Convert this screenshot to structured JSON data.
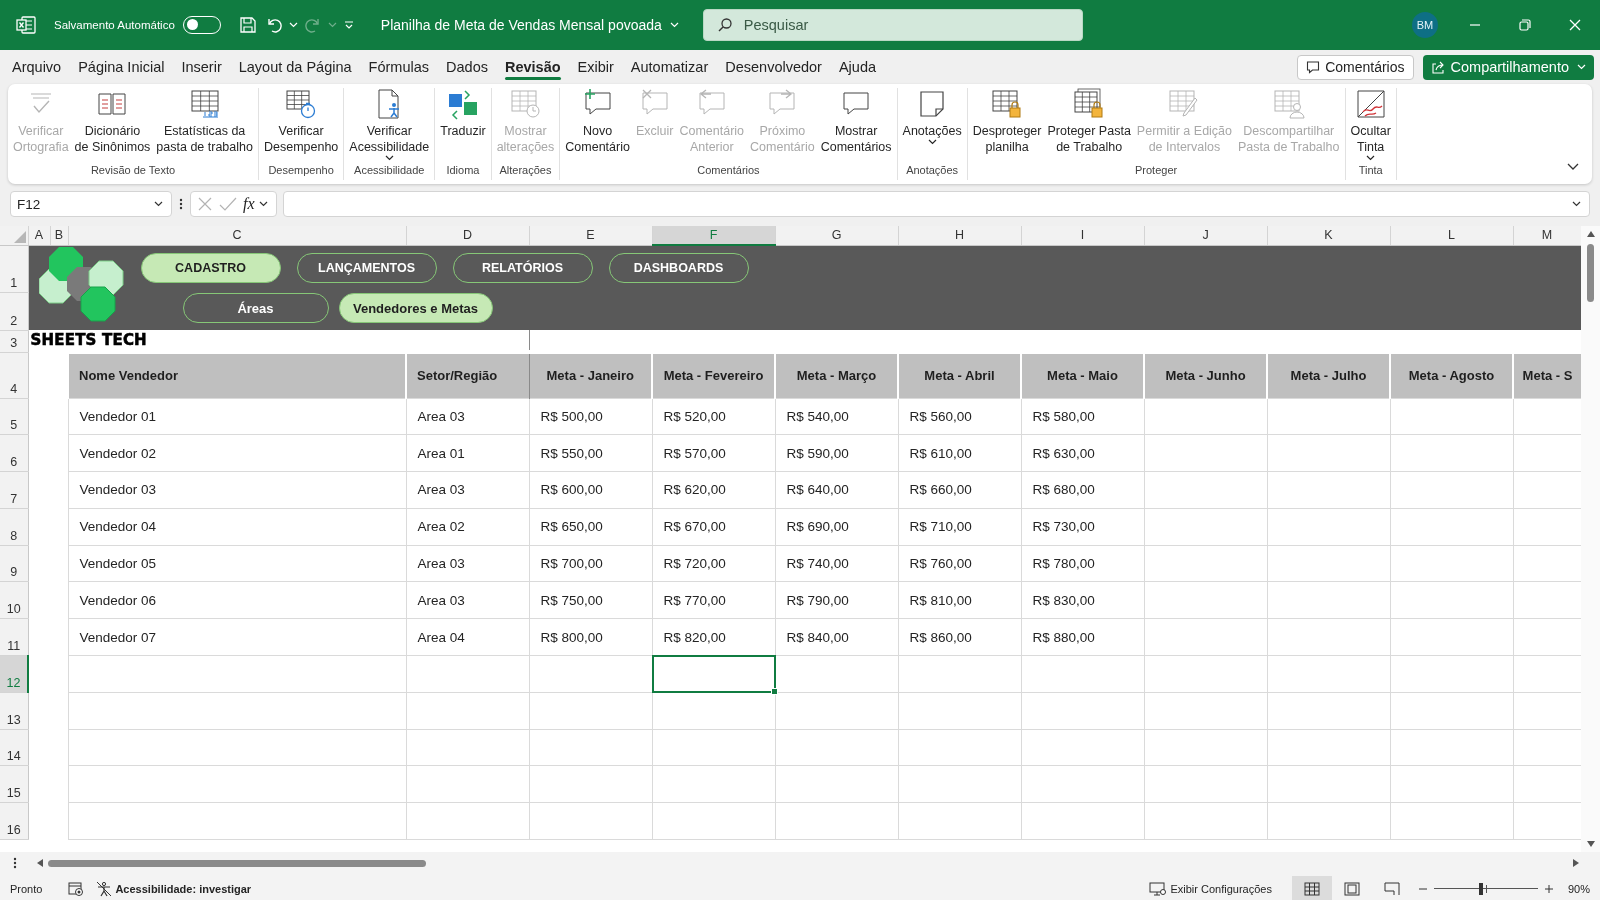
{
  "title_bar": {
    "autosave": {
      "label": "Salvamento Automático",
      "on": false
    },
    "redo": {
      "disabled": true
    },
    "document_title": "Planilha de Meta de Vendas Mensal povoada",
    "search": {
      "placeholder": "Pesquisar"
    },
    "user_initials": "BM"
  },
  "menu_tabs": [
    {
      "label": "Arquivo",
      "selected": false
    },
    {
      "label": "Página Inicial",
      "selected": false
    },
    {
      "label": "Inserir",
      "selected": false
    },
    {
      "label": "Layout da Página",
      "selected": false
    },
    {
      "label": "Fórmulas",
      "selected": false
    },
    {
      "label": "Dados",
      "selected": false
    },
    {
      "label": "Revisão",
      "selected": true
    },
    {
      "label": "Exibir",
      "selected": false
    },
    {
      "label": "Automatizar",
      "selected": false
    },
    {
      "label": "Desenvolvedor",
      "selected": false
    },
    {
      "label": "Ajuda",
      "selected": false
    }
  ],
  "header_buttons": {
    "comments": "Comentários",
    "share": "Compartilhamento"
  },
  "ribbon_groups": [
    {
      "label": "Revisão de Texto",
      "commands": [
        {
          "label": "Verificar\nOrtografia",
          "disabled": true,
          "has_menu": false
        },
        {
          "label": "Dicionário\nde Sinônimos",
          "disabled": false,
          "has_menu": false
        },
        {
          "label": "Estatísticas da\npasta de trabalho",
          "disabled": false,
          "has_menu": false
        }
      ]
    },
    {
      "label": "Desempenho",
      "commands": [
        {
          "label": "Verificar\nDesempenho",
          "disabled": false,
          "has_menu": false
        }
      ]
    },
    {
      "label": "Acessibilidade",
      "commands": [
        {
          "label": "Verificar\nAcessibilidade",
          "disabled": false,
          "has_menu": true
        }
      ]
    },
    {
      "label": "Idioma",
      "commands": [
        {
          "label": "Traduzir",
          "disabled": false,
          "has_menu": false
        }
      ]
    },
    {
      "label": "Alterações",
      "commands": [
        {
          "label": "Mostrar\nalterações",
          "disabled": true,
          "has_menu": false
        }
      ]
    },
    {
      "label": "Comentários",
      "commands": [
        {
          "label": "Novo\nComentário",
          "disabled": false,
          "has_menu": false
        },
        {
          "label": "Excluir",
          "disabled": true,
          "has_menu": false
        },
        {
          "label": "Comentário\nAnterior",
          "disabled": true,
          "has_menu": false
        },
        {
          "label": "Próximo\nComentário",
          "disabled": true,
          "has_menu": false
        },
        {
          "label": "Mostrar\nComentários",
          "disabled": false,
          "has_menu": false
        }
      ]
    },
    {
      "label": "Anotações",
      "commands": [
        {
          "label": "Anotações",
          "disabled": false,
          "has_menu": true
        }
      ]
    },
    {
      "label": "Proteger",
      "commands": [
        {
          "label": "Desproteger\nplanilha",
          "disabled": false,
          "has_menu": false
        },
        {
          "label": "Proteger Pasta\nde Trabalho",
          "disabled": false,
          "has_menu": false
        },
        {
          "label": "Permitir a Edição\nde Intervalos",
          "disabled": true,
          "has_menu": false
        },
        {
          "label": "Descompartilhar\nPasta de Trabalho",
          "disabled": true,
          "has_menu": false
        }
      ]
    },
    {
      "label": "Tinta",
      "commands": [
        {
          "label": "Ocultar\nTinta",
          "disabled": false,
          "has_menu": true
        }
      ]
    }
  ],
  "formula_bar": {
    "name_box": "F12",
    "edit_buttons_disabled": true,
    "function_label": "fx"
  },
  "column_bar": [
    {
      "letter": "A",
      "selected": false
    },
    {
      "letter": "B",
      "selected": false
    },
    {
      "letter": "C",
      "selected": false
    },
    {
      "letter": "D",
      "selected": false
    },
    {
      "letter": "E",
      "selected": false
    },
    {
      "letter": "F",
      "selected": true
    },
    {
      "letter": "G",
      "selected": false
    },
    {
      "letter": "H",
      "selected": false
    },
    {
      "letter": "I",
      "selected": false
    },
    {
      "letter": "J",
      "selected": false
    },
    {
      "letter": "K",
      "selected": false
    },
    {
      "letter": "L",
      "selected": false
    },
    {
      "letter": "M",
      "selected": false
    }
  ],
  "row_bar": [
    {
      "label": "1",
      "selected": false
    },
    {
      "label": "2",
      "selected": false
    },
    {
      "label": "3",
      "selected": false
    },
    {
      "label": "4",
      "selected": false
    },
    {
      "label": "5",
      "selected": false
    },
    {
      "label": "6",
      "selected": false
    },
    {
      "label": "7",
      "selected": false
    },
    {
      "label": "8",
      "selected": false
    },
    {
      "label": "9",
      "selected": false
    },
    {
      "label": "10",
      "selected": false
    },
    {
      "label": "11",
      "selected": false
    },
    {
      "label": "12",
      "selected": true
    },
    {
      "label": "13",
      "selected": false
    },
    {
      "label": "14",
      "selected": false
    },
    {
      "label": "15",
      "selected": false
    },
    {
      "label": "16",
      "selected": false
    }
  ],
  "sheet": {
    "banner": {
      "nav_buttons": [
        {
          "label": "CADASTRO",
          "selected": true
        },
        {
          "label": "LANÇAMENTOS",
          "selected": false
        },
        {
          "label": "RELATÓRIOS",
          "selected": false
        },
        {
          "label": "DASHBOARDS",
          "selected": false
        }
      ],
      "sub_buttons": [
        {
          "label": "Áreas",
          "selected": false
        },
        {
          "label": "Vendedores e Metas",
          "selected": true
        }
      ]
    },
    "brand": "SHEETS TECH",
    "header": [
      "Nome Vendedor",
      "Setor/Região",
      "Meta - Janeiro",
      "Meta - Fevereiro",
      "Meta - Março",
      "Meta - Abril",
      "Meta - Maio",
      "Meta - Junho",
      "Meta - Julho",
      "Meta - Agosto",
      "Meta - S"
    ],
    "rows": [
      [
        "Vendedor 01",
        "Area 03",
        "R$ 500,00",
        "R$ 520,00",
        "R$ 540,00",
        "R$ 560,00",
        "R$ 580,00"
      ],
      [
        "Vendedor 02",
        "Area 01",
        "R$ 550,00",
        "R$ 570,00",
        "R$ 590,00",
        "R$ 610,00",
        "R$ 630,00"
      ],
      [
        "Vendedor 03",
        "Area 03",
        "R$ 600,00",
        "R$ 620,00",
        "R$ 640,00",
        "R$ 660,00",
        "R$ 680,00"
      ],
      [
        "Vendedor 04",
        "Area 02",
        "R$ 650,00",
        "R$ 670,00",
        "R$ 690,00",
        "R$ 710,00",
        "R$ 730,00"
      ],
      [
        "Vendedor 05",
        "Area 03",
        "R$ 700,00",
        "R$ 720,00",
        "R$ 740,00",
        "R$ 760,00",
        "R$ 780,00"
      ],
      [
        "Vendedor 06",
        "Area 03",
        "R$ 750,00",
        "R$ 770,00",
        "R$ 790,00",
        "R$ 810,00",
        "R$ 830,00"
      ],
      [
        "Vendedor 07",
        "Area 04",
        "R$ 800,00",
        "R$ 820,00",
        "R$ 840,00",
        "R$ 860,00",
        "R$ 880,00"
      ]
    ]
  },
  "status_bar": {
    "mode": "Pronto",
    "accessibility": "Acessibilidade: investigar",
    "display_settings": "Exibir Configurações",
    "views": [
      {
        "selected": true
      },
      {
        "selected": false
      },
      {
        "selected": false
      }
    ],
    "zoom": {
      "level": 0.45,
      "reading": "90%"
    }
  }
}
